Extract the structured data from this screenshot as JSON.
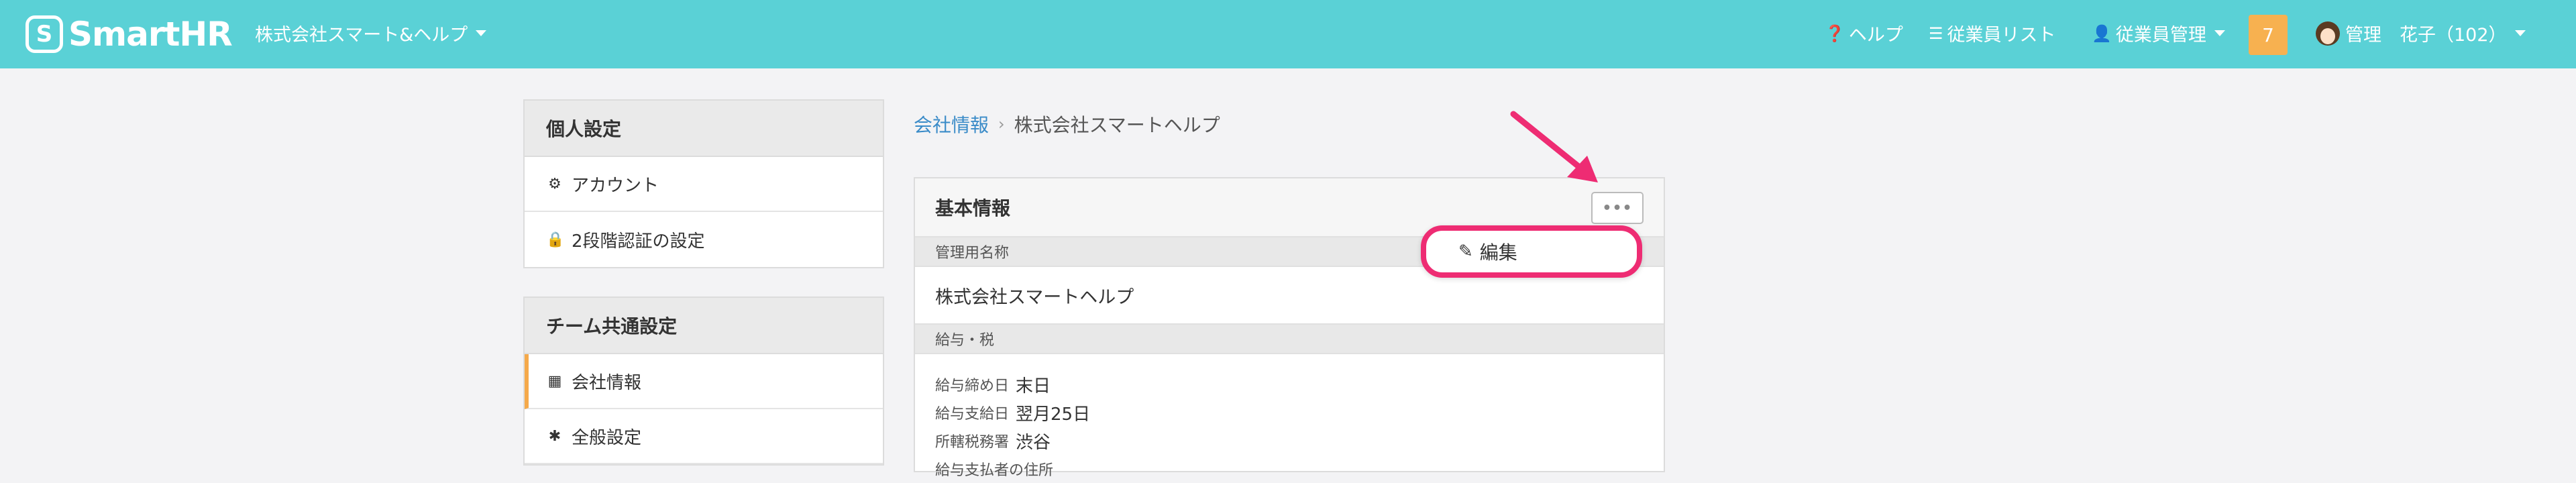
{
  "header": {
    "logo_mark": "S",
    "logo_text": "SmartHR",
    "company": "株式会社スマート&ヘルプ",
    "help": "ヘルプ",
    "employee_list": "従業員リスト",
    "employee_mgmt": "従業員管理",
    "notification_count": "7",
    "user": "管理　花子（102）"
  },
  "sidebar": {
    "personal_title": "個人設定",
    "personal_items": [
      {
        "label": "アカウント",
        "icon": "gear-icon"
      },
      {
        "label": "2段階認証の設定",
        "icon": "lock-icon"
      }
    ],
    "team_title": "チーム共通設定",
    "team_items": [
      {
        "label": "会社情報",
        "icon": "building-icon",
        "active": true
      },
      {
        "label": "全般設定",
        "icon": "asterisk-icon"
      }
    ]
  },
  "breadcrumb": {
    "link": "会社情報",
    "current": "株式会社スマートヘルプ"
  },
  "card": {
    "title": "基本情報",
    "more_label": "•••",
    "section1_label": "管理用名称",
    "section1_value": "株式会社スマートヘルプ",
    "section2_label": "給与・税",
    "rows": [
      {
        "key": "給与締め日",
        "value": "末日"
      },
      {
        "key": "給与支給日",
        "value": "翌月25日"
      },
      {
        "key": "所轄税務署",
        "value": "渋谷"
      },
      {
        "key": "給与支払者の住所",
        "value": ""
      }
    ]
  },
  "dropdown": {
    "edit_label": "編集"
  },
  "colors": {
    "header_bg": "#5ad1d6",
    "accent_pink": "#ee2c73",
    "badge_orange": "#f7b150",
    "link_blue": "#3a8bc8",
    "active_bar": "#f5a94a"
  }
}
